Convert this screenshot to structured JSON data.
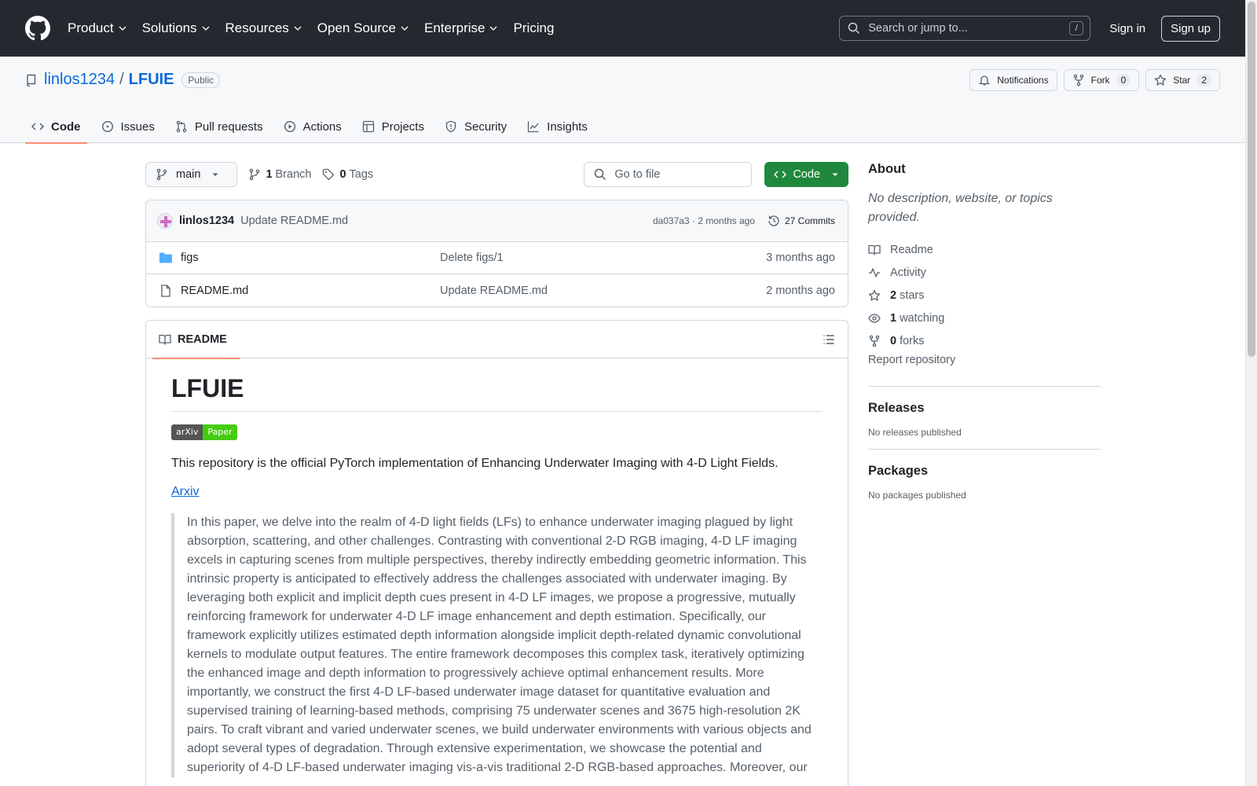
{
  "header": {
    "nav": [
      "Product",
      "Solutions",
      "Resources",
      "Open Source",
      "Enterprise",
      "Pricing"
    ],
    "search_placeholder": "Search or jump to...",
    "search_shortcut": "/",
    "signin": "Sign in",
    "signup": "Sign up"
  },
  "repo": {
    "owner": "linlos1234",
    "separator": "/",
    "name": "LFUIE",
    "visibility": "Public",
    "notifications": "Notifications",
    "fork_label": "Fork",
    "fork_count": "0",
    "star_label": "Star",
    "star_count": "2",
    "tabs": [
      "Code",
      "Issues",
      "Pull requests",
      "Actions",
      "Projects",
      "Security",
      "Insights"
    ]
  },
  "toolbar": {
    "branch": "main",
    "branch_count": "1",
    "branch_label": "Branch",
    "tag_count": "0",
    "tag_label": "Tags",
    "gofile_placeholder": "Go to file",
    "code_button": "Code"
  },
  "commit": {
    "author": "linlos1234",
    "message": "Update README.md",
    "hash_time": "da037a3 · 2 months ago",
    "commits": "27 Commits"
  },
  "files": [
    {
      "name": "figs",
      "commit": "Delete figs/1",
      "age": "3 months ago",
      "type": "folder"
    },
    {
      "name": "README.md",
      "commit": "Update README.md",
      "age": "2 months ago",
      "type": "file"
    }
  ],
  "readme": {
    "tab": "README",
    "title": "LFUIE",
    "badge_left": "arXiv",
    "badge_right": "Paper",
    "intro": "This repository is the official PyTorch implementation of Enhancing Underwater Imaging with 4-D Light Fields.",
    "link": "Arxiv",
    "abstract": "In this paper, we delve into the realm of 4-D light fields (LFs) to enhance underwater imaging plagued by light absorption, scattering, and other challenges. Contrasting with conventional 2-D RGB imaging, 4-D LF imaging excels in capturing scenes from multiple perspectives, thereby indirectly embedding geometric information. This intrinsic property is anticipated to effectively address the challenges associated with underwater imaging. By leveraging both explicit and implicit depth cues present in 4-D LF images, we propose a progressive, mutually reinforcing framework for underwater 4-D LF image enhancement and depth estimation. Specifically, our framework explicitly utilizes estimated depth information alongside implicit depth-related dynamic convolutional kernels to modulate output features. The entire framework decomposes this complex task, iteratively optimizing the enhanced image and depth information to progressively achieve optimal enhancement results. More importantly, we construct the first 4-D LF-based underwater image dataset for quantitative evaluation and supervised training of learning-based methods, comprising 75 underwater scenes and 3675 high-resolution 2K pairs. To craft vibrant and varied underwater scenes, we build underwater environments with various objects and adopt several types of degradation. Through extensive experimentation, we showcase the potential and superiority of 4-D LF-based underwater imaging vis-a-vis traditional 2-D RGB-based approaches. Moreover, our"
  },
  "about": {
    "title": "About",
    "description": "No description, website, or topics provided.",
    "readme": "Readme",
    "activity": "Activity",
    "stars_count": "2",
    "stars_label": "stars",
    "watching_count": "1",
    "watching_label": "watching",
    "forks_count": "0",
    "forks_label": "forks",
    "report": "Report repository"
  },
  "releases": {
    "title": "Releases",
    "empty": "No releases published"
  },
  "packages": {
    "title": "Packages",
    "empty": "No packages published"
  },
  "colors": {
    "primary_button": "#1f883d",
    "link": "#0969da",
    "header_bg": "#24292f",
    "tab_underline": "#fd8c73"
  }
}
